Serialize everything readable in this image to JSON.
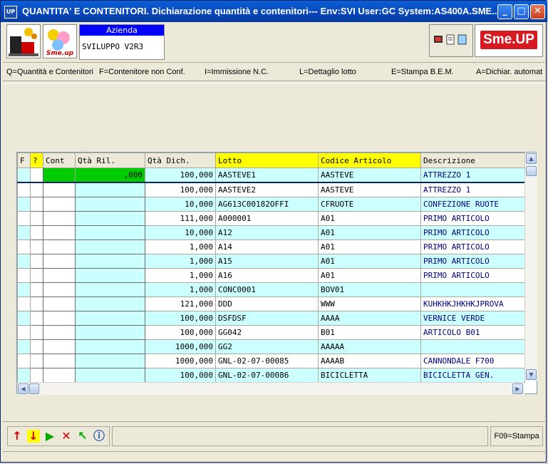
{
  "window": {
    "app_icon": "UP",
    "title": "QUANTITA' E CONTENITORI.  Dichiarazione quantità e contenitori--- Env:SVI User:GC System:AS400A.SME...",
    "minimize": "_",
    "maximize": "□",
    "close": "✕"
  },
  "header": {
    "azienda_label": "Azienda",
    "azienda_value": "SVILUPPO V2R3",
    "brand": "Sme.UP",
    "logo2_text": "Sme.up"
  },
  "fkeys": [
    "Q=Quantità e Contenitori",
    "F=Contenitore non Conf.",
    "I=Immissione N.C.",
    "L=Dettaglio lotto",
    "E=Stampa B.E.M.",
    "A=Dichiar. automat"
  ],
  "table": {
    "columns": [
      "F",
      "?",
      "Cont",
      "Qtà Ril.",
      "Qtà Dich.",
      "Lotto",
      "Codice Articolo",
      "Descrizione"
    ],
    "rows": [
      {
        "qta_ril": ",000",
        "qta_dich": "100,000",
        "lotto": "AASTEVE1",
        "codice": "AASTEVE",
        "descr": "ATTREZZO 1"
      },
      {
        "qta_ril": "",
        "qta_dich": "100,000",
        "lotto": "AASTEVE2",
        "codice": "AASTEVE",
        "descr": "ATTREZZO 1"
      },
      {
        "qta_ril": "",
        "qta_dich": "10,000",
        "lotto": "AG613C00182OFFI",
        "codice": "CFRUOTE",
        "descr": "CONFEZIONE RUOTE"
      },
      {
        "qta_ril": "",
        "qta_dich": "111,000",
        "lotto": "A000001",
        "codice": "A01",
        "descr": "PRIMO ARTICOLO"
      },
      {
        "qta_ril": "",
        "qta_dich": "10,000",
        "lotto": "A12",
        "codice": "A01",
        "descr": "PRIMO ARTICOLO"
      },
      {
        "qta_ril": "",
        "qta_dich": "1,000",
        "lotto": "A14",
        "codice": "A01",
        "descr": "PRIMO ARTICOLO"
      },
      {
        "qta_ril": "",
        "qta_dich": "1,000",
        "lotto": "A15",
        "codice": "A01",
        "descr": "PRIMO ARTICOLO"
      },
      {
        "qta_ril": "",
        "qta_dich": "1,000",
        "lotto": "A16",
        "codice": "A01",
        "descr": "PRIMO ARTICOLO"
      },
      {
        "qta_ril": "",
        "qta_dich": "1,000",
        "lotto": "CONC0001",
        "codice": "BOV01",
        "descr": ""
      },
      {
        "qta_ril": "",
        "qta_dich": "121,000",
        "lotto": "DDD",
        "codice": "WWW",
        "descr": "KUHKHKJHKHKJPROVA"
      },
      {
        "qta_ril": "",
        "qta_dich": "100,000",
        "lotto": "DSFDSF",
        "codice": "AAAA",
        "descr": "VERNICE VERDE"
      },
      {
        "qta_ril": "",
        "qta_dich": "100,000",
        "lotto": "GG042",
        "codice": "B01",
        "descr": "ARTICOLO B01"
      },
      {
        "qta_ril": "",
        "qta_dich": "1000,000",
        "lotto": "GG2",
        "codice": "AAAAA",
        "descr": ""
      },
      {
        "qta_ril": "",
        "qta_dich": "1000,000",
        "lotto": "GNL-02-07-00085",
        "codice": "AAAAB",
        "descr": "CANNONDALE F700"
      },
      {
        "qta_ril": "",
        "qta_dich": "100,000",
        "lotto": "GNL-02-07-00086",
        "codice": "BICICLETTA",
        "descr": "BICICLETTA GEN."
      }
    ]
  },
  "footer": {
    "f09": "F09=Stampa"
  }
}
